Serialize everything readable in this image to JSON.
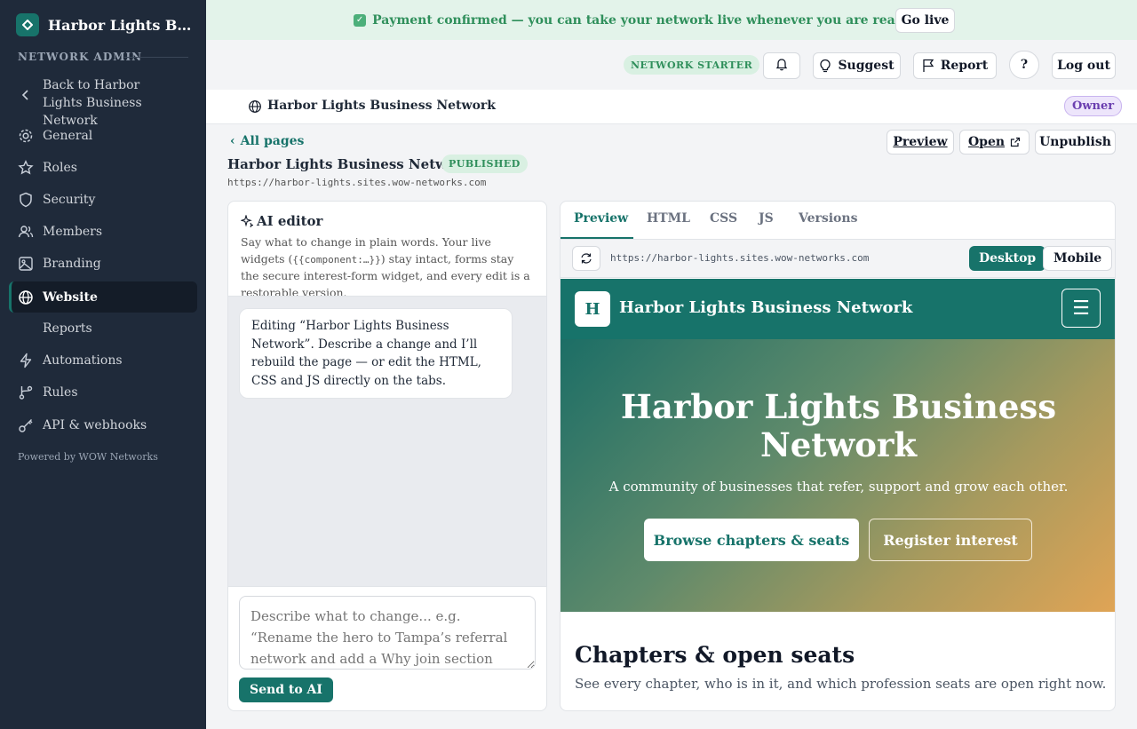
{
  "banner": {
    "text": "Payment confirmed — you can take your network live whenever you are ready.",
    "go_live": "Go live"
  },
  "sidebar": {
    "app_title": "Harbor Lights Business Network",
    "section": "NETWORK ADMIN",
    "back": "Back to Harbor Lights Business Network",
    "items": [
      {
        "label": "General",
        "icon": "gear-icon"
      },
      {
        "label": "Roles",
        "icon": "star-icon"
      },
      {
        "label": "Security",
        "icon": "shield-icon"
      },
      {
        "label": "Members",
        "icon": "users-icon"
      },
      {
        "label": "Branding",
        "icon": "image-icon"
      },
      {
        "label": "Website",
        "icon": "globe-icon"
      },
      {
        "label": "Reports",
        "icon": ""
      },
      {
        "label": "Automations",
        "icon": "lightning-icon"
      },
      {
        "label": "Rules",
        "icon": "branch-icon"
      },
      {
        "label": "API & webhooks",
        "icon": "key-icon"
      }
    ],
    "powered": "Powered by WOW Networks"
  },
  "topbar": {
    "plan": "NETWORK STARTER",
    "suggest": "Suggest",
    "report": "Report",
    "help": "?",
    "logout": "Log out"
  },
  "sitebar": {
    "name": "Harbor Lights Business Network",
    "role": "Owner"
  },
  "page": {
    "back": "All pages",
    "title": "Harbor Lights Business Network",
    "status": "PUBLISHED",
    "url": "https://harbor-lights.sites.wow-networks.com",
    "preview": "Preview",
    "open": "Open",
    "unpublish": "Unpublish"
  },
  "ai": {
    "title": "AI editor",
    "desc_1": "Say what to change in plain words. Your live widgets (",
    "desc_code": "{{component:…}}",
    "desc_2": ") stay intact, forms stay the secure interest-form widget, and every edit is a restorable version.",
    "message": "Editing “Harbor Lights Business Network”. Describe a change and I’ll rebuild the page — or edit the HTML, CSS and JS directly on the tabs.",
    "placeholder": "Describe what to change... e.g. “Rename the hero to Tampa’s referral network and add a Why join section with three points.”",
    "send": "Send to AI"
  },
  "preview": {
    "tabs": [
      "Preview",
      "HTML",
      "CSS",
      "JS",
      "Versions"
    ],
    "url": "https://harbor-lights.sites.wow-networks.com",
    "desktop": "Desktop",
    "mobile": "Mobile",
    "site": {
      "logo": "H",
      "name": "Harbor Lights Business Network",
      "hero_title": "Harbor Lights Business Network",
      "hero_sub": "A community of businesses that refer, support and grow each other.",
      "cta_primary": "Browse chapters & seats",
      "cta_secondary": "Register interest",
      "section_title": "Chapters & open seats",
      "section_sub": "See every chapter, who is in it, and which profession seats are open right now."
    }
  },
  "colors": {
    "accent": "#17736a",
    "sidebar": "#1f2a3a",
    "banner": "#e3f3ea"
  }
}
